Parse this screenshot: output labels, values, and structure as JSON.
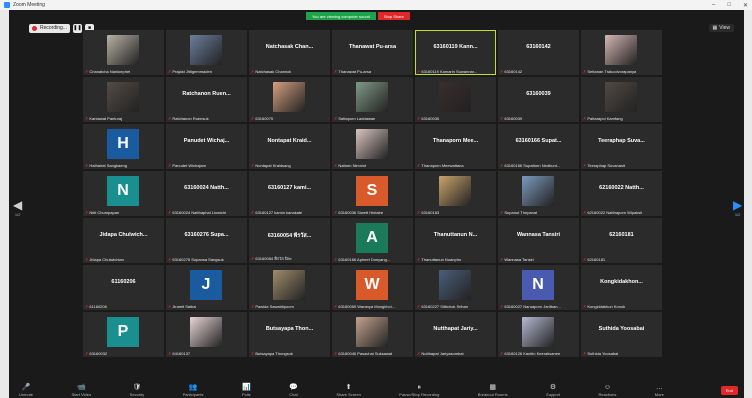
{
  "window": {
    "title": "Zoom Meeting",
    "controls": [
      "–",
      "□",
      "✕"
    ]
  },
  "recording": {
    "label": "Recording...",
    "pause": "❚❚",
    "stop": "■"
  },
  "share": {
    "message": "You are viewing computer sound",
    "stop_label": "Stop Share"
  },
  "view_button": {
    "label": "View"
  },
  "nav": {
    "left_page": "1/2",
    "right_page": "1/2"
  },
  "participants": [
    {
      "label": "Chanatcha Narkkephet",
      "type": "photo",
      "color": "#b9b2a6"
    },
    {
      "label": "Prajakt Jittigemmaden",
      "type": "photo",
      "color": "#6c7e9d"
    },
    {
      "label": "Natchasak Channok",
      "center": "Natchasak Chan...",
      "type": "name"
    },
    {
      "label": "Thanawat Pu-arsa",
      "center": "Thanawat Pu-arsa",
      "type": "name"
    },
    {
      "label": "63160119 Kamarin Suwannar...",
      "center": "63160119 Kann...",
      "type": "name",
      "active": true
    },
    {
      "label": "63160142",
      "center": "63160142",
      "type": "name"
    },
    {
      "label": "Settanan Trakoolvorapanya",
      "type": "photo",
      "color": "#d4b7b4"
    },
    {
      "label": "Kantawat Panturaj",
      "type": "photo",
      "color": "#554c45"
    },
    {
      "label": "Ratchanon Ruensuk",
      "center": "Ratchanon Ruen...",
      "type": "name"
    },
    {
      "label": "63160075",
      "type": "photo",
      "color": "#d49f7f"
    },
    {
      "label": "Sattaporn Laddawan",
      "type": "photo",
      "color": "#7f9a86"
    },
    {
      "label": "63160035",
      "type": "photo",
      "color": "#3a2d2d"
    },
    {
      "label": "63160039",
      "center": "63160039",
      "type": "name"
    },
    {
      "label": "Pattarapol Kamfang",
      "type": "photo",
      "color": "#504a45"
    },
    {
      "label": "Hathairat Sangkaeng",
      "type": "avatar",
      "letter": "H",
      "color": "#1a5a9e"
    },
    {
      "label": "Panudet Wichajarn",
      "center": "Panudet Wichaj...",
      "type": "name"
    },
    {
      "label": "Nontapat Kraidsang",
      "center": "Nontapat Kraid...",
      "type": "name"
    },
    {
      "label": "Nattorn Nimnint",
      "type": "photo",
      "color": "#d9c4bf"
    },
    {
      "label": "Thanaporn Meewattana",
      "center": "Thanaporn Mee...",
      "type": "name"
    },
    {
      "label": "63160166 Supattorn Nedbunt...",
      "center": "63160166 Supat...",
      "type": "name"
    },
    {
      "label": "Teeraphap Suvanasit",
      "center": "Teeraphap Suva...",
      "type": "name"
    },
    {
      "label": "Nitit Chumpapan",
      "type": "avatar",
      "letter": "N",
      "color": "#1a8f8f"
    },
    {
      "label": "63160024 Natthaphal Liowicht",
      "center": "63160024 Natth...",
      "type": "name"
    },
    {
      "label": "63160127 kamin kanakate",
      "center": "63160127 kami...",
      "type": "name"
    },
    {
      "label": "63160036 Siwett Hintaire",
      "type": "avatar",
      "letter": "S",
      "color": "#d85a2a"
    },
    {
      "label": "63160163",
      "type": "photo",
      "color": "#c9a46b"
    },
    {
      "label": "Supanut Thepanat",
      "type": "photo",
      "color": "#7d9abf"
    },
    {
      "label": "62160022 Natthaporn Wipaksit",
      "center": "62160022 Natth...",
      "type": "name"
    },
    {
      "label": "Jidapa Chulwichian",
      "center": "Jidapa Chulwich...",
      "type": "name"
    },
    {
      "label": "63160276 Supansa Sangsuk",
      "center": "63160276 Supa...",
      "type": "name"
    },
    {
      "label": "63160054 พีรวัส ปิยะ",
      "center": "63160054 พีรวัส...",
      "type": "name"
    },
    {
      "label": "63160166 Apheet Donyang...",
      "type": "avatar",
      "letter": "A",
      "color": "#1a7a5a"
    },
    {
      "label": "Thanuttanun Nuanpho",
      "center": "Thanuttanun N...",
      "type": "name"
    },
    {
      "label": "Wannasa Tansiri",
      "center": "Wannasa Tansiri",
      "type": "name"
    },
    {
      "label": "62160181",
      "center": "62160181",
      "type": "name"
    },
    {
      "label": "61160206",
      "center": "61160206",
      "type": "name"
    },
    {
      "label": "Jiramit Saibal",
      "type": "avatar",
      "letter": "J",
      "color": "#1a5a9e"
    },
    {
      "label": "Pawida Sawatdipoom",
      "type": "photo",
      "color": "#a08c6c"
    },
    {
      "label": "63160059 Waranya Mongkhol...",
      "type": "avatar",
      "letter": "W",
      "color": "#d85a2a"
    },
    {
      "label": "63160227 Sittichok Sriban",
      "type": "photo",
      "color": "#4a5f7a"
    },
    {
      "label": "63160027 Naruaporn Jaritban...",
      "type": "avatar",
      "letter": "N",
      "color": "#4a5ab0"
    },
    {
      "label": "Kongkidakhun Konok",
      "center": "Kongkidakhon...",
      "type": "name"
    },
    {
      "label": "63160032",
      "type": "avatar",
      "letter": "P",
      "color": "#1a8f8f"
    },
    {
      "label": "64160137",
      "type": "photo",
      "color": "#e8d5d5"
    },
    {
      "label": "Butsayapa Thongsuk",
      "center": "Butsayapa Thon...",
      "type": "name"
    },
    {
      "label": "63160046 Pasachai Suksawat",
      "type": "photo",
      "color": "#c2a38c"
    },
    {
      "label": "Nutthapat Jariyasombat",
      "center": "Nutthapat Jariy...",
      "type": "name"
    },
    {
      "label": "63160126 Kanitin Keeratisanee",
      "type": "photo",
      "color": "#b5b9d2"
    },
    {
      "label": "Suthida Yoosabai",
      "center": "Suthida Yoosabai",
      "type": "name"
    }
  ],
  "toolbar": {
    "items": [
      {
        "label": "Unmute",
        "icon": "🎤"
      },
      {
        "label": "Start Video",
        "icon": "📹"
      },
      {
        "label": "Security",
        "icon": "🛡"
      },
      {
        "label": "Participants",
        "icon": "👥"
      },
      {
        "label": "Polls",
        "icon": "📊"
      },
      {
        "label": "Chat",
        "icon": "💬"
      },
      {
        "label": "Share Screen",
        "icon": "⬆"
      },
      {
        "label": "Pause/Stop Recording",
        "icon": "⏸"
      },
      {
        "label": "Breakout Rooms",
        "icon": "▦"
      },
      {
        "label": "Support",
        "icon": "⚙"
      },
      {
        "label": "Reactions",
        "icon": "☺"
      },
      {
        "label": "More",
        "icon": "…"
      }
    ],
    "end_label": "End"
  }
}
